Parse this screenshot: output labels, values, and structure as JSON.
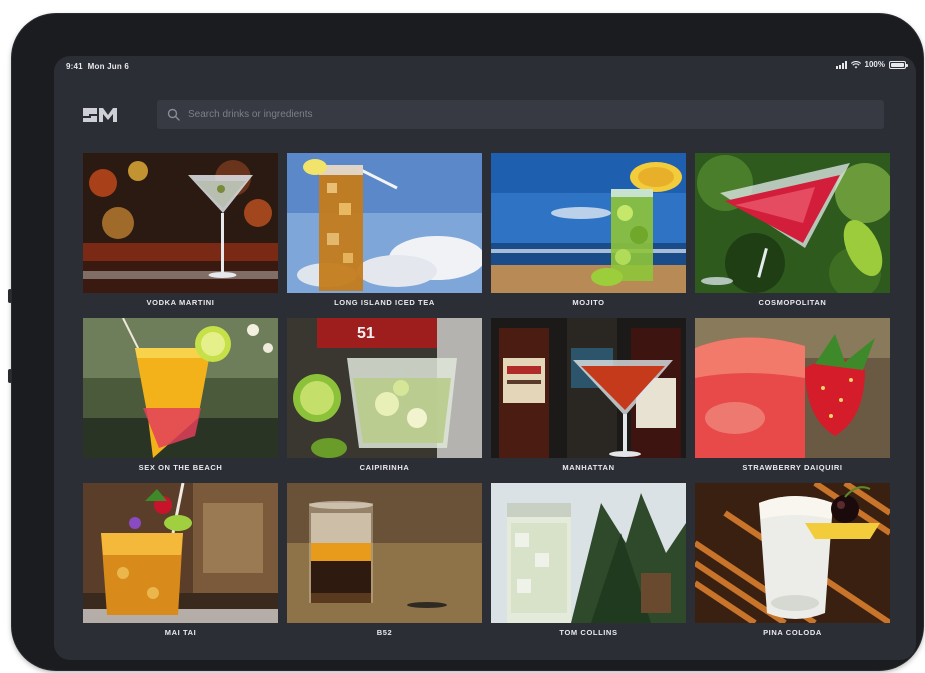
{
  "status_bar": {
    "time": "9:41",
    "date": "Mon Jun 6",
    "battery": "100%",
    "battery_level": 1.0
  },
  "search": {
    "placeholder": "Search drinks or ingredients"
  },
  "brand": {
    "logo_icon": "brand-logo-icon"
  },
  "colors": {
    "background": "#2c2e36",
    "search_field": "#383a43",
    "label_text": "#e9e9ee"
  },
  "drinks": [
    {
      "name": "VODKA MARTINI"
    },
    {
      "name": "LONG ISLAND ICED TEA"
    },
    {
      "name": "MOJITO"
    },
    {
      "name": "COSMOPOLITAN"
    },
    {
      "name": "SEX ON THE BEACH"
    },
    {
      "name": "CAIPIRINHA"
    },
    {
      "name": "MANHATTAN"
    },
    {
      "name": "STRAWBERRY DAIQUIRI"
    },
    {
      "name": "MAI TAI"
    },
    {
      "name": "B52"
    },
    {
      "name": "TOM COLLINS"
    },
    {
      "name": "PINA COLODA"
    }
  ]
}
